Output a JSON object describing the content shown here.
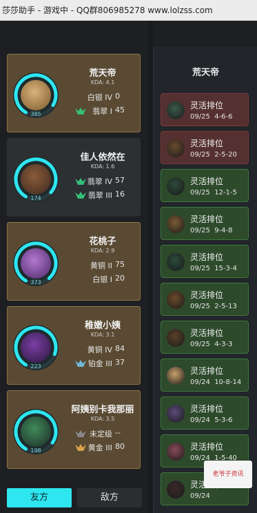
{
  "window": {
    "title": "莎莎助手 - 游戏中 - QQ群806985278 www.lolzss.com"
  },
  "team_tabs": {
    "friend": "友方",
    "enemy": "敌方"
  },
  "players": [
    {
      "name": "荒天帝",
      "kda": "KDA: 4.1",
      "level": "385",
      "ranks": [
        {
          "tier": "白银 IV",
          "points": "0"
        },
        {
          "tier": "翡翠 I",
          "points": "45"
        }
      ],
      "rank_icons": [
        "none",
        "emerald-emblem-icon"
      ]
    },
    {
      "name": "佳人依然在",
      "kda": "KDA: 1.6",
      "level": "174",
      "ranks": [
        {
          "tier": "翡翠 IV",
          "points": "57"
        },
        {
          "tier": "翡翠 III",
          "points": "16"
        }
      ],
      "rank_icons": [
        "emerald-emblem-icon",
        "emerald-emblem-icon"
      ]
    },
    {
      "name": "花桃子",
      "kda": "KDA: 2.9",
      "level": "373",
      "ranks": [
        {
          "tier": "黄铜 II",
          "points": "75"
        },
        {
          "tier": "白银 I",
          "points": "20"
        }
      ],
      "rank_icons": [
        "none",
        "none"
      ]
    },
    {
      "name": "稚嫩小姨",
      "kda": "KDA: 3.1",
      "level": "223",
      "ranks": [
        {
          "tier": "黄铜 IV",
          "points": "84"
        },
        {
          "tier": "铂金 III",
          "points": "37"
        }
      ],
      "rank_icons": [
        "none",
        "platinum-emblem-icon"
      ]
    },
    {
      "name": "阿姨别卡我那丽",
      "kda": "KDA: 3.5",
      "level": "198",
      "ranks": [
        {
          "tier": "未定级",
          "points": "--"
        },
        {
          "tier": "黄金 III",
          "points": "80"
        }
      ],
      "rank_icons": [
        "unranked-emblem-icon",
        "gold-emblem-icon"
      ]
    }
  ],
  "history": {
    "player_name": "荒天帝",
    "matches": [
      {
        "mode": "灵活排位",
        "date": "09/25",
        "score": "4-6-6",
        "result": "loss"
      },
      {
        "mode": "灵活排位",
        "date": "09/25",
        "score": "2-5-20",
        "result": "loss"
      },
      {
        "mode": "灵活排位",
        "date": "09/25",
        "score": "12-1-5",
        "result": "win"
      },
      {
        "mode": "灵活排位",
        "date": "09/25",
        "score": "9-4-8",
        "result": "win"
      },
      {
        "mode": "灵活排位",
        "date": "09/25",
        "score": "15-3-4",
        "result": "win"
      },
      {
        "mode": "灵活排位",
        "date": "09/25",
        "score": "2-5-13",
        "result": "win"
      },
      {
        "mode": "灵活排位",
        "date": "09/25",
        "score": "4-3-3",
        "result": "win"
      },
      {
        "mode": "灵活排位",
        "date": "09/24",
        "score": "10-8-14",
        "result": "win"
      },
      {
        "mode": "灵活排位",
        "date": "09/24",
        "score": "5-3-6",
        "result": "win"
      },
      {
        "mode": "灵活排位",
        "date": "09/24",
        "score": "1-5-40",
        "result": "win"
      },
      {
        "mode": "灵活排位",
        "date": "09/24",
        "score": "",
        "result": "win"
      }
    ]
  },
  "watermark": {
    "text": "老爷子资讯"
  },
  "colors": {
    "accent": "#2ee6f0",
    "win": "#2d4a2b",
    "loss": "#553030"
  }
}
